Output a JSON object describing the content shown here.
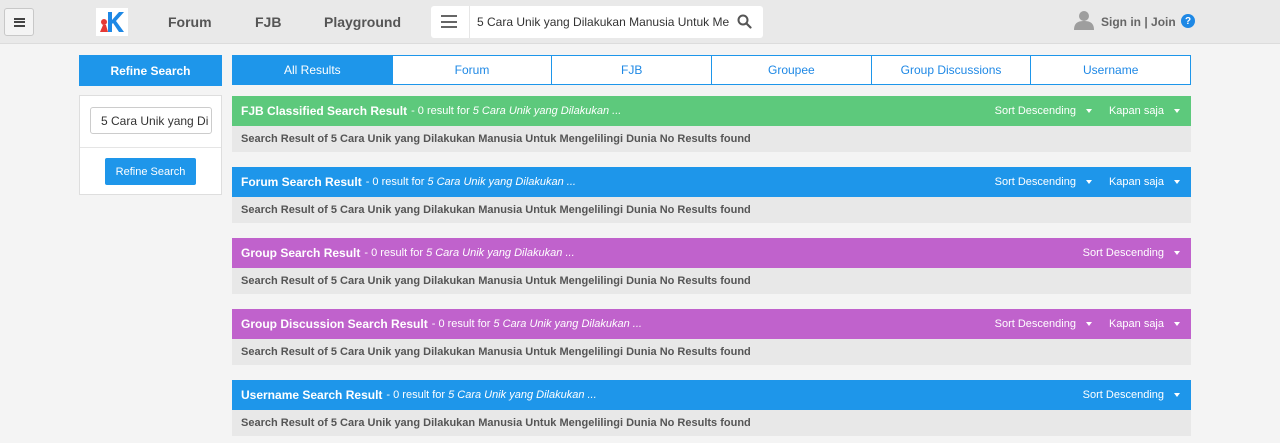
{
  "header": {
    "nav": [
      "Forum",
      "FJB",
      "Playground"
    ],
    "search_value": "5 Cara Unik yang Dilakukan Manusia Untuk Me",
    "signin_label": "Sign in | Join",
    "help_label": "?"
  },
  "sidebar": {
    "title": "Refine Search",
    "input_value": "5 Cara Unik yang Di",
    "button_label": "Refine Search"
  },
  "tabs": [
    "All Results",
    "Forum",
    "FJB",
    "Groupee",
    "Group Discussions",
    "Username"
  ],
  "active_tab": "All Results",
  "sections": [
    {
      "title": "FJB Classified Search Result",
      "meta": "- 0 result for",
      "query": "5 Cara Unik yang Dilakukan ...",
      "sort_label": "Sort Descending",
      "time_label": "Kapan saja",
      "body": "Search Result of 5 Cara Unik yang Dilakukan Manusia Untuk Mengelilingi Dunia No Results found"
    },
    {
      "title": "Forum Search Result",
      "meta": "- 0 result for",
      "query": "5 Cara Unik yang Dilakukan ...",
      "sort_label": "Sort Descending",
      "time_label": "Kapan saja",
      "body": "Search Result of 5 Cara Unik yang Dilakukan Manusia Untuk Mengelilingi Dunia No Results found"
    },
    {
      "title": "Group Search Result",
      "meta": "- 0 result for",
      "query": "5 Cara Unik yang Dilakukan ...",
      "sort_label": "Sort Descending",
      "body": "Search Result of 5 Cara Unik yang Dilakukan Manusia Untuk Mengelilingi Dunia No Results found"
    },
    {
      "title": "Group Discussion Search Result",
      "meta": "- 0 result for",
      "query": "5 Cara Unik yang Dilakukan ...",
      "sort_label": "Sort Descending",
      "time_label": "Kapan saja",
      "body": "Search Result of 5 Cara Unik yang Dilakukan Manusia Untuk Mengelilingi Dunia No Results found"
    },
    {
      "title": "Username Search Result",
      "meta": "- 0 result for",
      "query": "5 Cara Unik yang Dilakukan ...",
      "sort_label": "Sort Descending",
      "body": "Search Result of 5 Cara Unik yang Dilakukan Manusia Untuk Mengelilingi Dunia No Results found"
    }
  ],
  "colors": {
    "primary": "#1e96ea",
    "fjb": "#5dc97c",
    "forum": "#1e96ea",
    "group": "#c062cc",
    "group_discussion": "#c062cc",
    "username": "#1e96ea"
  },
  "icons": [
    "hamburger-icon",
    "kaskus-logo",
    "list-icon",
    "search-icon",
    "user-icon",
    "help-icon",
    "caret-down-icon"
  ]
}
